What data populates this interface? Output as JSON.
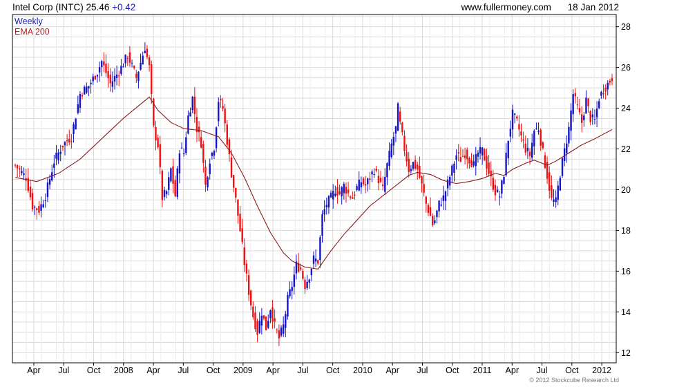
{
  "header": {
    "title": "Intel Corp (INTC)",
    "price": "25.46",
    "change": "+0.42",
    "source": "www.fullermoney.com",
    "date": "18 Jan 2012"
  },
  "footer": {
    "copyright": "© 2012 Stockcube Research Ltd"
  },
  "chart_data": {
    "type": "candlestick",
    "interval_label": "Weekly",
    "indicator_label": "EMA 200",
    "colors": {
      "up": "#1414c8",
      "down": "#ee1111",
      "ema": "#8b1a1a",
      "grid": "#d9d9d9",
      "axis": "#000000",
      "interval_label": "#1a1aa8",
      "indicator_label": "#b22222"
    },
    "ylim": [
      11.5,
      28.6
    ],
    "y_ticks": [
      12,
      14,
      16,
      18,
      20,
      22,
      24,
      26,
      28
    ],
    "x_ticks": [
      "Apr",
      "Jul",
      "Oct",
      "2008",
      "Apr",
      "Jul",
      "Oct",
      "2009",
      "Apr",
      "Jul",
      "Oct",
      "2010",
      "Apr",
      "Jul",
      "Oct",
      "2011",
      "Apr",
      "Jul",
      "Oct",
      "2012"
    ],
    "grid": true,
    "price_path": [
      [
        0,
        21.2
      ],
      [
        5,
        20.6
      ],
      [
        8,
        19.2
      ],
      [
        11,
        19.0
      ],
      [
        14,
        19.7
      ],
      [
        18,
        21.4
      ],
      [
        22,
        22.2
      ],
      [
        26,
        22.6
      ],
      [
        30,
        24.7
      ],
      [
        34,
        25.1
      ],
      [
        38,
        25.8
      ],
      [
        40,
        26.3
      ],
      [
        44,
        25.2
      ],
      [
        48,
        25.8
      ],
      [
        52,
        26.6
      ],
      [
        56,
        25.5
      ],
      [
        60,
        27.0
      ],
      [
        62,
        26.0
      ],
      [
        64,
        23.0
      ],
      [
        66,
        22.2
      ],
      [
        68,
        19.6
      ],
      [
        70,
        19.9
      ],
      [
        72,
        21.0
      ],
      [
        74,
        19.7
      ],
      [
        76,
        22.0
      ],
      [
        78,
        21.8
      ],
      [
        80,
        23.6
      ],
      [
        82,
        24.5
      ],
      [
        84,
        23.0
      ],
      [
        86,
        22.3
      ],
      [
        88,
        20.2
      ],
      [
        90,
        21.5
      ],
      [
        92,
        22.1
      ],
      [
        94,
        24.4
      ],
      [
        96,
        24.0
      ],
      [
        98,
        22.4
      ],
      [
        100,
        20.8
      ],
      [
        102,
        19.5
      ],
      [
        104,
        18.0
      ],
      [
        106,
        16.4
      ],
      [
        108,
        15.0
      ],
      [
        110,
        13.8
      ],
      [
        112,
        13.0
      ],
      [
        114,
        14.0
      ],
      [
        116,
        13.2
      ],
      [
        118,
        14.2
      ],
      [
        120,
        13.3
      ],
      [
        122,
        12.7
      ],
      [
        124,
        13.3
      ],
      [
        126,
        14.6
      ],
      [
        128,
        15.3
      ],
      [
        130,
        16.3
      ],
      [
        132,
        16.1
      ],
      [
        134,
        15.3
      ],
      [
        136,
        15.8
      ],
      [
        138,
        16.6
      ],
      [
        140,
        16.5
      ],
      [
        142,
        18.7
      ],
      [
        144,
        19.3
      ],
      [
        146,
        19.6
      ],
      [
        148,
        20.0
      ],
      [
        150,
        19.8
      ],
      [
        152,
        20.2
      ],
      [
        154,
        19.8
      ],
      [
        156,
        19.6
      ],
      [
        158,
        20.1
      ],
      [
        160,
        20.4
      ],
      [
        162,
        20.2
      ],
      [
        164,
        20.6
      ],
      [
        166,
        21.0
      ],
      [
        168,
        20.5
      ],
      [
        170,
        20.0
      ],
      [
        172,
        21.2
      ],
      [
        174,
        22.2
      ],
      [
        176,
        23.0
      ],
      [
        177,
        24.0
      ],
      [
        178,
        23.2
      ],
      [
        180,
        22.0
      ],
      [
        182,
        21.0
      ],
      [
        184,
        21.3
      ],
      [
        186,
        21.0
      ],
      [
        188,
        20.2
      ],
      [
        190,
        19.3
      ],
      [
        192,
        18.7
      ],
      [
        193,
        18.3
      ],
      [
        194,
        18.5
      ],
      [
        196,
        19.3
      ],
      [
        198,
        19.6
      ],
      [
        200,
        20.3
      ],
      [
        202,
        21.0
      ],
      [
        204,
        21.7
      ],
      [
        206,
        21.5
      ],
      [
        208,
        21.8
      ],
      [
        210,
        21.5
      ],
      [
        212,
        21.2
      ],
      [
        214,
        21.8
      ],
      [
        216,
        21.9
      ],
      [
        218,
        21.2
      ],
      [
        220,
        20.5
      ],
      [
        222,
        19.9
      ],
      [
        224,
        19.7
      ],
      [
        226,
        20.8
      ],
      [
        228,
        22.5
      ],
      [
        230,
        23.7
      ],
      [
        232,
        23.3
      ],
      [
        234,
        22.6
      ],
      [
        236,
        22.0
      ],
      [
        238,
        21.7
      ],
      [
        240,
        22.9
      ],
      [
        242,
        23.0
      ],
      [
        244,
        21.8
      ],
      [
        246,
        20.7
      ],
      [
        248,
        19.5
      ],
      [
        250,
        19.4
      ],
      [
        252,
        20.8
      ],
      [
        254,
        21.9
      ],
      [
        256,
        23.0
      ],
      [
        258,
        24.7
      ],
      [
        260,
        24.0
      ],
      [
        262,
        23.3
      ],
      [
        264,
        24.4
      ],
      [
        266,
        23.5
      ],
      [
        268,
        23.4
      ],
      [
        270,
        24.5
      ],
      [
        272,
        24.9
      ],
      [
        274,
        25.2
      ],
      [
        276,
        25.5
      ]
    ],
    "ema_path": [
      [
        0,
        20.6
      ],
      [
        10,
        20.4
      ],
      [
        20,
        20.8
      ],
      [
        30,
        21.5
      ],
      [
        40,
        22.5
      ],
      [
        50,
        23.5
      ],
      [
        58,
        24.2
      ],
      [
        62,
        24.55
      ],
      [
        66,
        23.9
      ],
      [
        72,
        23.3
      ],
      [
        78,
        23.0
      ],
      [
        86,
        22.9
      ],
      [
        94,
        22.6
      ],
      [
        100,
        21.8
      ],
      [
        106,
        20.6
      ],
      [
        112,
        19.2
      ],
      [
        118,
        17.9
      ],
      [
        124,
        16.9
      ],
      [
        128,
        16.5
      ],
      [
        134,
        16.2
      ],
      [
        140,
        16.1
      ],
      [
        146,
        17.0
      ],
      [
        152,
        17.8
      ],
      [
        158,
        18.5
      ],
      [
        164,
        19.2
      ],
      [
        170,
        19.7
      ],
      [
        176,
        20.2
      ],
      [
        182,
        20.7
      ],
      [
        186,
        20.85
      ],
      [
        192,
        20.75
      ],
      [
        198,
        20.45
      ],
      [
        204,
        20.3
      ],
      [
        210,
        20.4
      ],
      [
        216,
        20.55
      ],
      [
        222,
        20.8
      ],
      [
        226,
        20.7
      ],
      [
        230,
        21.0
      ],
      [
        236,
        21.3
      ],
      [
        240,
        21.45
      ],
      [
        246,
        21.2
      ],
      [
        250,
        21.4
      ],
      [
        256,
        21.8
      ],
      [
        262,
        22.2
      ],
      [
        268,
        22.5
      ],
      [
        276,
        22.95
      ]
    ]
  }
}
